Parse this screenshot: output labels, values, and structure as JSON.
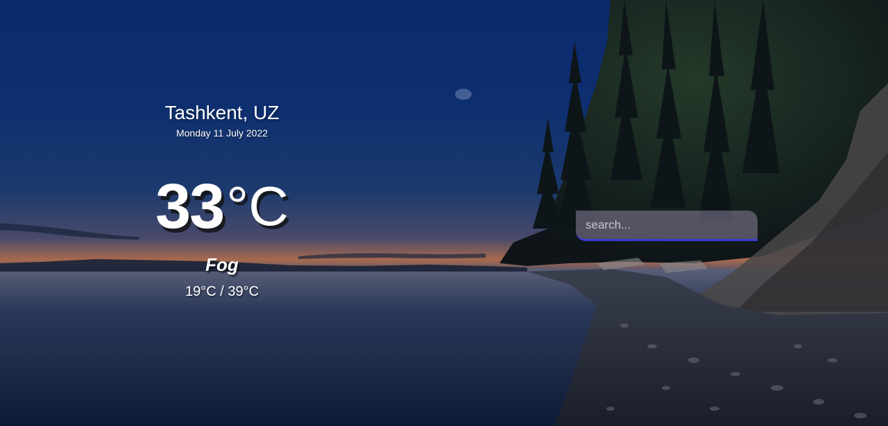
{
  "location": {
    "city": "Tashkent, UZ",
    "date": "Monday 11 July 2022"
  },
  "current": {
    "temperature": "33",
    "unit": "°C",
    "condition": "Fog",
    "range": "19°C / 39°C"
  },
  "search": {
    "placeholder": "search...",
    "value": ""
  },
  "colors": {
    "search_underline": "#3a3ad8",
    "text": "#ffffff"
  }
}
